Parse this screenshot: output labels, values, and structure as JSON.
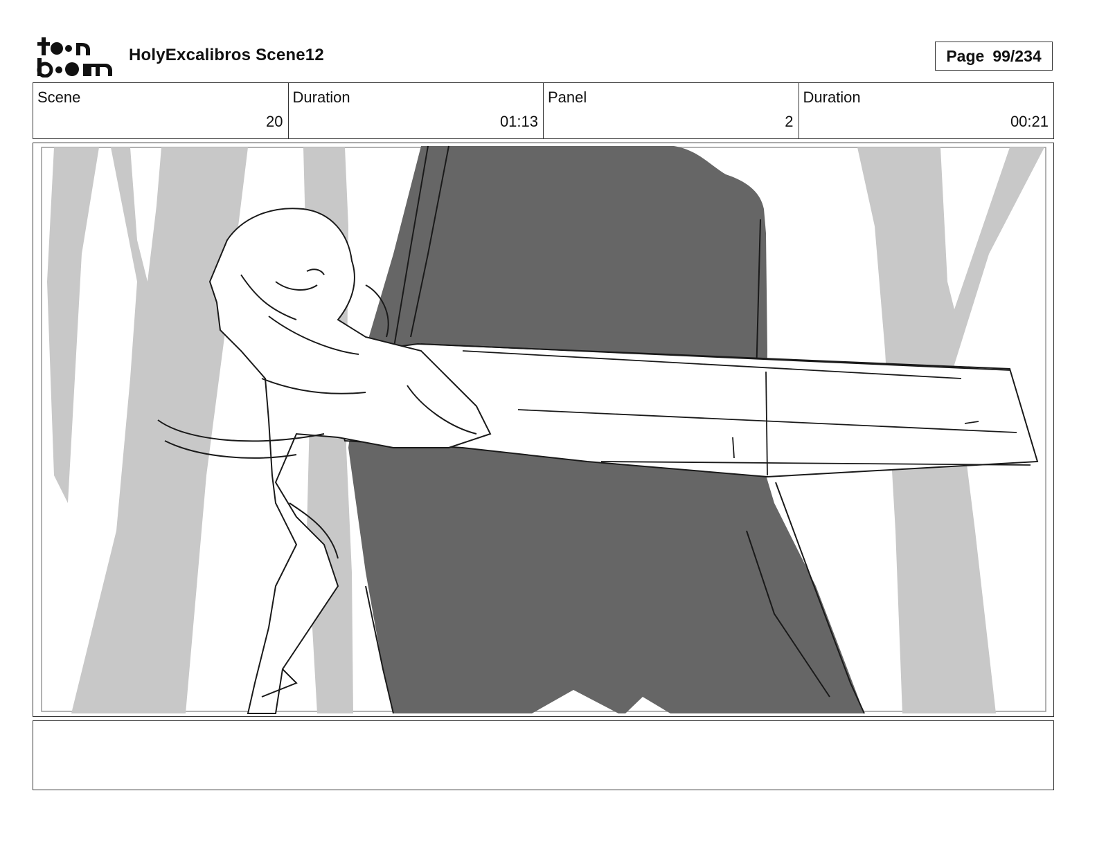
{
  "header": {
    "logo_alt": "toon boom",
    "title": "HolyExcalibros Scene12",
    "page_label": "Page",
    "page_value": "99/234"
  },
  "info": [
    {
      "label": "Scene",
      "value": "20"
    },
    {
      "label": "Duration",
      "value": "01:13"
    },
    {
      "label": "Panel",
      "value": "2"
    },
    {
      "label": "Duration",
      "value": "00:21"
    }
  ],
  "panel": {
    "description": "",
    "colors": {
      "tree_light": "#c8c8c8",
      "tree_dark": "#666666",
      "line": "#1a1a1a"
    }
  },
  "notes": {
    "text": ""
  }
}
